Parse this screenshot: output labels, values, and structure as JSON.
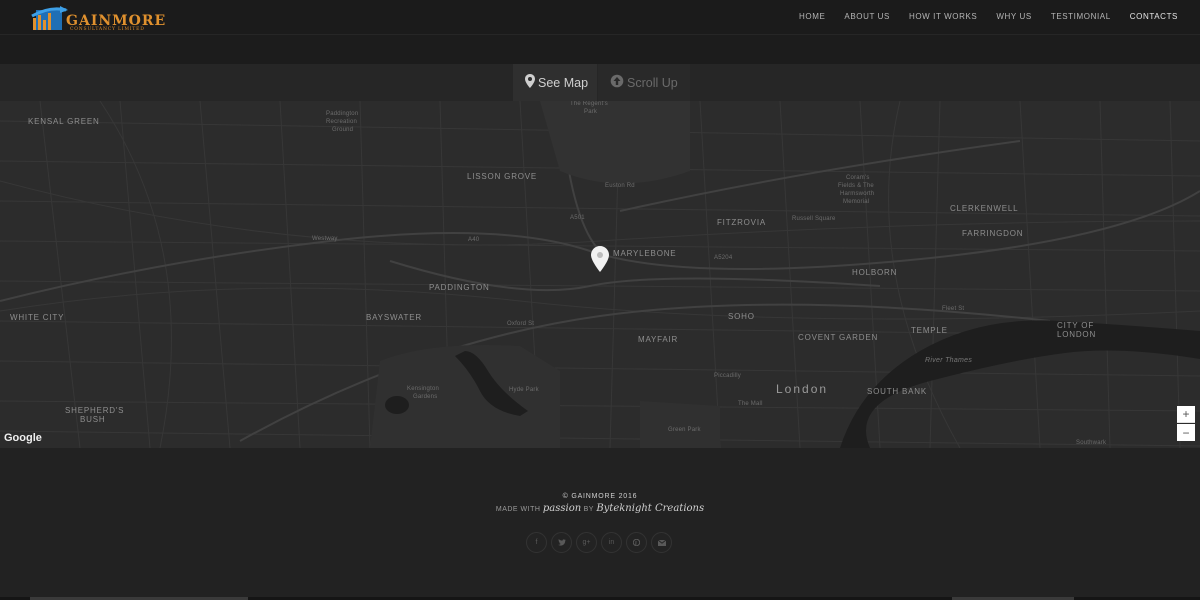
{
  "brand": {
    "name": "GAINMORE",
    "tagline": "CONSULTANCY LIMITED"
  },
  "nav": {
    "items": [
      "HOME",
      "ABOUT US",
      "HOW IT WORKS",
      "WHY US",
      "TESTIMONIAL",
      "CONTACTS"
    ],
    "active": "CONTACTS"
  },
  "tabs": {
    "see_map": "See Map",
    "scroll_up": "Scroll Up"
  },
  "map": {
    "areas": [
      "KENSAL GREEN",
      "LISSON GROVE",
      "FITZROVIA",
      "CLERKENWELL",
      "FARRINGDON",
      "MARYLEBONE",
      "PADDINGTON",
      "HOLBORN",
      "WHITE CITY",
      "BAYSWATER",
      "SOHO",
      "TEMPLE",
      "CITY OF",
      "LONDON",
      "MAYFAIR",
      "COVENT GARDEN",
      "SHEPHERD'S",
      "BUSH",
      "SOUTH BANK"
    ],
    "city": "London",
    "minor": [
      "Paddington",
      "Recreation",
      "Ground",
      "The Regent's",
      "Park",
      "Coram's",
      "Fields & The",
      "Harmsworth",
      "Memorial",
      "Russell Square",
      "Kensington",
      "Gardens",
      "Hyde Park",
      "Green Park",
      "River Thames",
      "Westway",
      "A40",
      "A501",
      "A5204",
      "Oxford St",
      "Piccadilly",
      "The Mall",
      "Southwark",
      "Fleet St",
      "Euston Rd"
    ],
    "attribution": "Google",
    "zoom_in": "+",
    "zoom_out": "−"
  },
  "footer": {
    "copyright": "© GAINMORE 2016",
    "made_with": "MADE WITH",
    "passion": "passion",
    "by": "BY",
    "author": "Byteknight Creations",
    "social_icons": [
      "facebook-icon",
      "twitter-icon",
      "google-plus-icon",
      "linkedin-icon",
      "pinterest-icon",
      "email-icon"
    ]
  },
  "colors": {
    "background": "#222222",
    "brand_orange": "#e0912e",
    "brand_blue": "#1f6fb5",
    "map_bg": "#2c2c2c",
    "road": "#3a3a3a"
  }
}
